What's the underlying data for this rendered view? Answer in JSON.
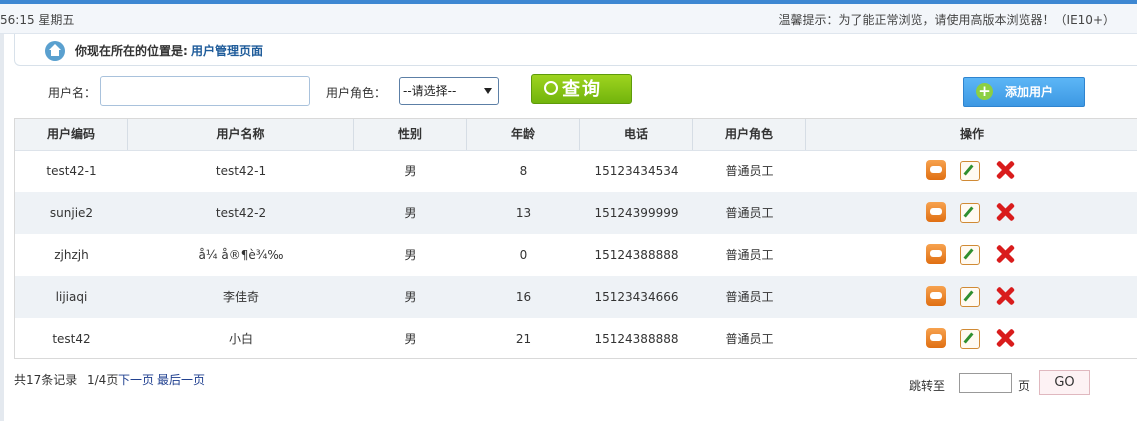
{
  "top_bar": {
    "datetime": "56:15 星期五",
    "tip": "温馨提示：为了能正常浏览，请使用高版本浏览器！（IE10+）"
  },
  "breadcrumb": {
    "icon": "home-icon",
    "label": "你现在所在的位置是:",
    "current": "用户管理页面"
  },
  "search": {
    "username_label": "用户名：",
    "username_value": "",
    "role_label": "用户角色：",
    "role_selected": "--请选择--",
    "query_button": "查询",
    "add_button": "添加用户"
  },
  "table": {
    "headers": [
      "用户编码",
      "用户名称",
      "性别",
      "年龄",
      "电话",
      "用户角色",
      "操作"
    ],
    "rows": [
      {
        "code": "test42-1",
        "name": "test42-1",
        "gender": "男",
        "age": "8",
        "phone": "15123434534",
        "role": "普通员工"
      },
      {
        "code": "sunjie2",
        "name": "test42-2",
        "gender": "男",
        "age": "13",
        "phone": "15124399999",
        "role": "普通员工"
      },
      {
        "code": "zjhzjh",
        "name": "å¼ å®¶è¾‰",
        "gender": "男",
        "age": "0",
        "phone": "15124388888",
        "role": "普通员工"
      },
      {
        "code": "lijiaqi",
        "name": "李佳奇",
        "gender": "男",
        "age": "16",
        "phone": "15123434666",
        "role": "普通员工"
      },
      {
        "code": "test42",
        "name": "小白",
        "gender": "男",
        "age": "21",
        "phone": "15124388888",
        "role": "普通员工"
      }
    ],
    "action_icons": [
      "view-icon",
      "edit-icon",
      "delete-icon"
    ]
  },
  "pagination": {
    "total": "共17条记录",
    "pages": "1/4页",
    "next": "下一页",
    "last": "最后一页",
    "jump_label": "跳转至",
    "jump_value": "",
    "jump_unit": "页",
    "go_button": "GO"
  },
  "colors": {
    "query_button": "#7bbd12",
    "add_button": "#4aa5ec",
    "delete_icon": "#d91c1c",
    "link": "#1f5c9a"
  }
}
